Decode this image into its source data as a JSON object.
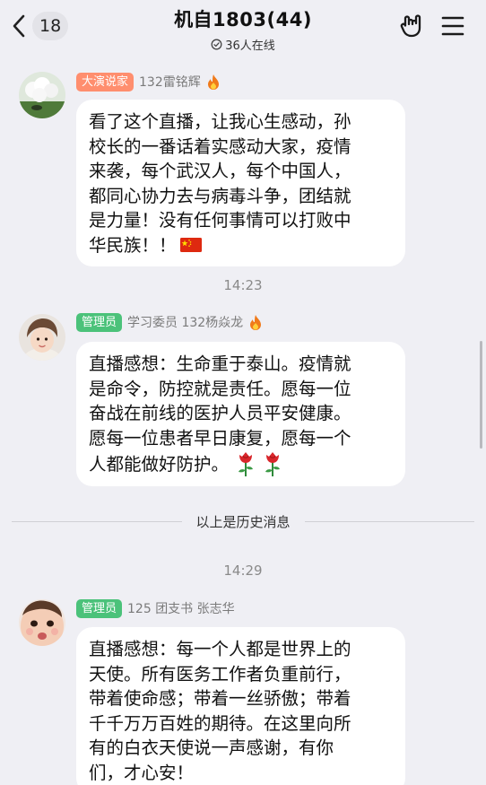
{
  "header": {
    "unread_count": "18",
    "title": "机自1803(44)",
    "online_text": "36人在线"
  },
  "messages": [
    {
      "badge": "大演说家",
      "badge_color": "#ff8e6e",
      "sender": "132雷铭辉",
      "lines": [
        "看了这个直播，让我心生感动，孙",
        "校长的一番话着实感动大家，疫情",
        "来袭，每个武汉人，每个中国人，",
        "都同心协力去与病毒斗争，团结就",
        "是力量！没有任何事情可以打败中",
        "华民族！！"
      ],
      "emoji": "china-flag"
    },
    {
      "time": "14:23",
      "badge": "管理员",
      "badge_color": "#4bc27a",
      "sender": "学习委员 132杨焱龙",
      "lines": [
        "直播感想：生命重于泰山。疫情就",
        "是命令，防控就是责任。愿每一位",
        "奋战在前线的医护人员平安健康。",
        "愿每一位患者早日康复，愿每一个",
        "人都能做好防护。"
      ],
      "emoji": "rose"
    },
    {
      "time": "14:29",
      "badge": "管理员",
      "badge_color": "#4bc27a",
      "sender": "125 团支书 张志华",
      "lines": [
        "直播感想：每一个人都是世界上的",
        "天使。所有医务工作者负重前行，",
        "带着使命感；带着一丝骄傲；带着",
        "千千万万百姓的期待。在这里向所",
        "有的白衣天使说一声感谢，有你",
        "们，才心安！"
      ]
    }
  ],
  "history_divider": "以上是历史消息"
}
